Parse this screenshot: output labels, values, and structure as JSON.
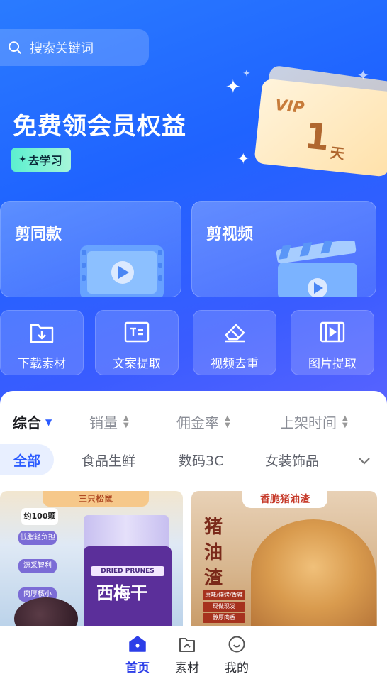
{
  "search": {
    "placeholder": "搜索关键词"
  },
  "banner": {
    "title": "免费领会员权益",
    "learn_button": "去学习",
    "vip": {
      "label": "VIP",
      "number": "1",
      "unit": "天"
    }
  },
  "big_cards": [
    {
      "label": "剪同款"
    },
    {
      "label": "剪视频"
    }
  ],
  "tools": [
    {
      "label": "下载素材",
      "icon": "download-folder-icon"
    },
    {
      "label": "文案提取",
      "icon": "text-extract-icon"
    },
    {
      "label": "视频去重",
      "icon": "eraser-icon"
    },
    {
      "label": "图片提取",
      "icon": "film-frame-icon"
    }
  ],
  "sort": {
    "items": [
      {
        "label": "综合",
        "active": true
      },
      {
        "label": "销量"
      },
      {
        "label": "佣金率"
      },
      {
        "label": "上架时间"
      }
    ]
  },
  "categories": {
    "items": [
      "全部",
      "食品生鲜",
      "数码3C",
      "女装饰品"
    ],
    "active": "全部"
  },
  "products": [
    {
      "brand": "三只松鼠",
      "badge": "约100颗",
      "features": [
        "低脂轻负担",
        "源采智利",
        "肉厚核小"
      ],
      "pack_en": "DRIED PRUNES",
      "pack_cn": "西梅干"
    },
    {
      "banner": "香脆猪油渣",
      "vertical_text": [
        "猪",
        "油",
        "渣"
      ],
      "tags": [
        "原味/烧烤/香辣",
        "现做现发",
        "醇厚肉香"
      ]
    }
  ],
  "tabbar": {
    "items": [
      {
        "label": "首页",
        "active": true
      },
      {
        "label": "素材"
      },
      {
        "label": "我的"
      }
    ]
  },
  "colors": {
    "accent": "#2c5cff",
    "hero_top": "#2a7bff",
    "learn_btn": "#5cf0cf",
    "vip_gold": "#b0672f"
  }
}
